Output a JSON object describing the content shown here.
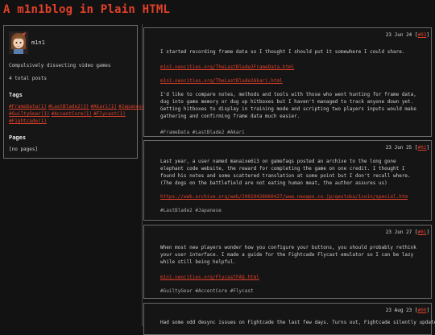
{
  "site": {
    "title": "A m1n1blog in Plain HTML"
  },
  "sidebar": {
    "username": "m1n1",
    "description": "Compulsively dissecting video games",
    "total_posts": "4 total posts",
    "tags_heading": "Tags",
    "tags": [
      "#FrameData(1)",
      "#LastBlade2(3)",
      "#Akari(1)",
      "#Japanese(1)",
      "#GuiltyGear(1)",
      "#AccentCore(1)",
      "#Flycast(1)",
      "#Fightcade(1)"
    ],
    "pages_heading": "Pages",
    "pages_text": "[no pages]"
  },
  "posts": [
    {
      "date": "23 Jun 24",
      "num": "#03",
      "body": "I started recording frame data so I thought I should put it somewhere I could share.",
      "links": [
        "m1n1.neocities.org/TheLastBlade2FrameData.html",
        "m1n1.neocities.org/TheLastBlade2Akari.html"
      ],
      "body2": "I'd like to compare notes, methods and tools with those who went hunting for frame data, dug into game memory or dug up hitboxes but I haven't managed to track anyone down yet. Getting hitboxes to display in training mode and scripting two players inputs would make gathering and confirming frame data much easier.",
      "hashtags": "#FrameData #LastBlade2 #Akari"
    },
    {
      "date": "23 Jun 25",
      "num": "#02",
      "body": "Last year, a user named manaixe613 on gamefaqs posted an archive to the long gone elephant code website, the reward for completing the game on one credit. I thought I found his notes and some scattered translation at some point but I don't recall where. (The dogs on the battlefield are not eating human meat, the author assures us)",
      "links": [
        "https://web.archive.org/web/20010426060427/www.neogeo.co.jp/gestuka/1coin/special.htm"
      ],
      "hashtags": "#LastBlade2 #Japanese"
    },
    {
      "date": "23 Jun 27",
      "num": "#01",
      "body": "When most new players wonder how you configure your buttons, you should probably rethink your user interface. I made a guide for the Fightcade Flycast emulator so I can be lazy while still being helpful.",
      "links": [
        "m1n1.neocities.org/FlycastFAQ.html"
      ],
      "hashtags": "#GuiltyGear #AccentCore #Flycast"
    },
    {
      "date": "23 Aug 23",
      "num": "#00",
      "body": "Had some odd desync issues on Fightcade the last few days. Turns out, Fightcade silently updated the"
    }
  ]
}
